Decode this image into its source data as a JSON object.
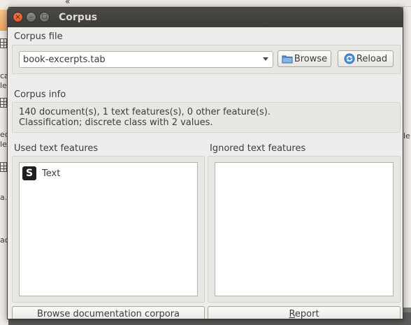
{
  "window": {
    "title": "Corpus",
    "close_glyph": "×",
    "minimize_glyph": "–",
    "maximize_glyph": "□"
  },
  "background": {
    "chevron": "«",
    "fragments": [
      "ec",
      "le",
      "ca",
      "le",
      "a.",
      "ac",
      "le"
    ]
  },
  "corpus_file": {
    "group_title": "Corpus file",
    "selected_file": "book-excerpts.tab",
    "browse_label": "Browse",
    "reload_label": "Reload"
  },
  "corpus_info": {
    "group_title": "Corpus info",
    "line1": "140 document(s), 1 text features(s), 0 other feature(s).",
    "line2": "Classification; discrete class with 2 values."
  },
  "used_features": {
    "group_title": "Used text features",
    "items": [
      {
        "badge": "S",
        "label": "Text"
      }
    ]
  },
  "ignored_features": {
    "group_title": "Ignored text features",
    "items": []
  },
  "bottom_buttons": {
    "browse_docs_label": "Browse documentation corpora",
    "report_label": "Report"
  },
  "colors": {
    "titlebar": "#3c3b37",
    "close_button": "#df4a16",
    "window_bg": "#efedeb"
  }
}
